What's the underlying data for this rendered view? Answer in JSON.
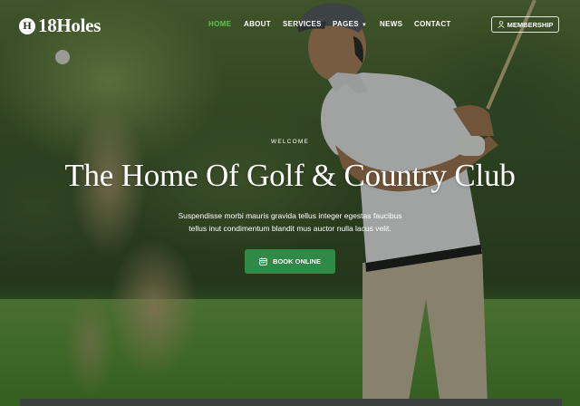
{
  "brand": {
    "badge": "H",
    "name": "18Holes"
  },
  "nav": {
    "items": [
      {
        "label": "HOME",
        "active": true
      },
      {
        "label": "ABOUT",
        "active": false
      },
      {
        "label": "SERVICES",
        "active": false
      },
      {
        "label": "PAGES",
        "active": false,
        "has_dropdown": true
      },
      {
        "label": "NEWS",
        "active": false
      },
      {
        "label": "CONTACT",
        "active": false
      }
    ],
    "membership_label": "MEMBERSHIP"
  },
  "hero": {
    "eyebrow": "WELCOME",
    "title": "The Home Of Golf & Country Club",
    "subtitle_line1": "Suspendisse morbi mauris gravida tellus integer egestas faucibus",
    "subtitle_line2": "tellus inut condimentum blandit mus auctor nulla lacus velit.",
    "cta_label": "BOOK ONLINE"
  },
  "colors": {
    "accent": "#5bc64f",
    "cta": "#2e8a46"
  },
  "icons": {
    "membership": "user-icon",
    "cta": "calendar-icon",
    "dropdown": "chevron-down-icon"
  }
}
